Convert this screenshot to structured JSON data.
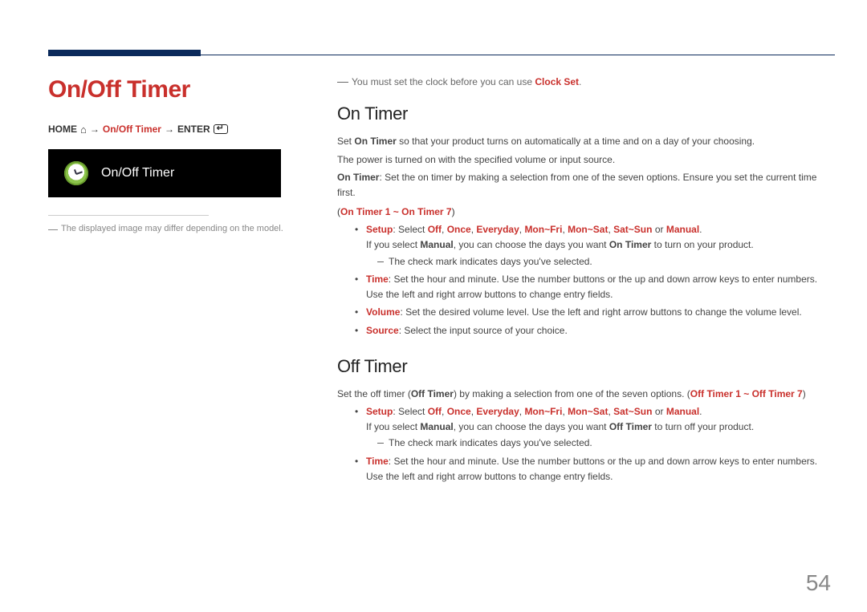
{
  "left": {
    "title": "On/Off Timer",
    "breadcrumb": {
      "home": "HOME",
      "path1": "On/Off Timer",
      "enter": "ENTER"
    },
    "screenshot_label": "On/Off Timer",
    "footnote": "The displayed image may differ depending on the model."
  },
  "right": {
    "clock_note_pre": "You must set the clock before you can use ",
    "clock_note_bold": "Clock Set",
    "clock_note_post": ".",
    "on": {
      "heading": "On Timer",
      "p1_pre": "Set ",
      "p1_b": "On Timer",
      "p1_post": " so that your product turns on automatically at a time and on a day of your choosing.",
      "p2": "The power is turned on with the specified volume or input source.",
      "p3_b": "On Timer",
      "p3_post": ": Set the on timer by making a selection from one of the seven options. Ensure you set the current time first.",
      "paren": "On Timer 1 ~ On Timer 7",
      "b1": {
        "lead": "Setup",
        "mid": ": Select ",
        "o1": "Off",
        "o2": "Once",
        "o3": "Everyday",
        "o4": "Mon~Fri",
        "o5": "Mon~Sat",
        "o6": "Sat~Sun",
        "o7": "Manual",
        "tail": ".",
        "l2_pre": "If you select ",
        "l2_b1": "Manual",
        "l2_mid": ", you can choose the days you want ",
        "l2_b2": "On Timer",
        "l2_post": " to turn on your product.",
        "sub": "The check mark indicates days you've selected."
      },
      "b2": {
        "lead": "Time",
        "text": ": Set the hour and minute. Use the number buttons or the up and down arrow keys to enter numbers. Use the left and right arrow buttons to change entry fields."
      },
      "b3": {
        "lead": "Volume",
        "text": ": Set the desired volume level. Use the left and right arrow buttons to change the volume level."
      },
      "b4": {
        "lead": "Source",
        "text": ": Select the input source of your choice."
      }
    },
    "off": {
      "heading": "Off Timer",
      "p1_pre": "Set the off timer (",
      "p1_b1": "Off Timer",
      "p1_mid": ") by making a selection from one of the seven options. (",
      "p1_b2": "Off Timer 1 ~ Off Timer 7",
      "p1_post": ")",
      "b1": {
        "lead": "Setup",
        "mid": ": Select ",
        "o1": "Off",
        "o2": "Once",
        "o3": "Everyday",
        "o4": "Mon~Fri",
        "o5": "Mon~Sat",
        "o6": "Sat~Sun",
        "o7": "Manual",
        "tail": ".",
        "l2_pre": "If you select ",
        "l2_b1": "Manual",
        "l2_mid": ", you can choose the days you want ",
        "l2_b2": "Off Timer",
        "l2_post": " to turn off your product.",
        "sub": "The check mark indicates days you've selected."
      },
      "b2": {
        "lead": "Time",
        "text": ": Set the hour and minute. Use the number buttons or the up and down arrow keys to enter numbers. Use the left and right arrow buttons to change entry fields."
      }
    }
  },
  "page_number": "54"
}
